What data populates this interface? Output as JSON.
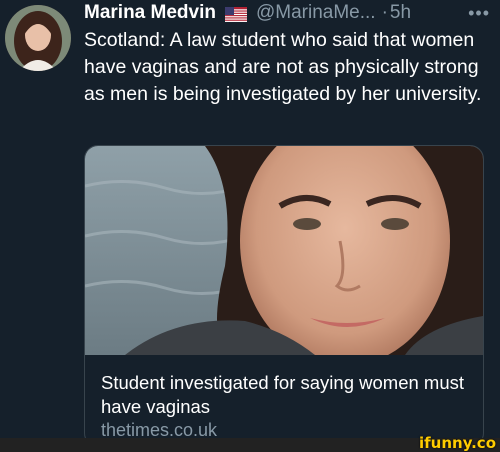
{
  "tweet": {
    "author": {
      "display_name": "Marina Medvin",
      "flag_icon": "us-flag-icon",
      "handle": "@MarinaMe...",
      "separator": "·",
      "time": "5h"
    },
    "more_label": "•••",
    "text": "Scotland: A law student who said that women have vaginas and are not as physically strong as men is being investigated by her university.",
    "card": {
      "title": "Student investigated for saying women must have vaginas",
      "domain": "thetimes.co.uk"
    }
  },
  "watermark": "ifunny.co",
  "colors": {
    "background": "#15202b",
    "secondary_text": "#8899a6",
    "border": "#38444d",
    "watermark": "#ffcc00"
  }
}
